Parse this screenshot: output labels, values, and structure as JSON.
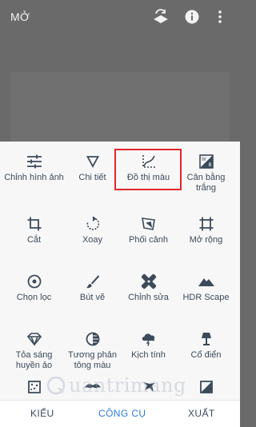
{
  "header": {
    "title": "MỞ",
    "icons": [
      "layers-undo-icon",
      "info-icon",
      "more-vert-icon"
    ]
  },
  "tools": [
    {
      "label": "Chỉnh hình ảnh",
      "icon": "tune-sliders-icon"
    },
    {
      "label": "Chi tiết",
      "icon": "details-triangle-icon"
    },
    {
      "label": "Đồ thị màu",
      "icon": "curves-icon"
    },
    {
      "label": "Cân bằng trắng",
      "icon": "white-balance-icon"
    },
    {
      "label": "Cắt",
      "icon": "crop-icon"
    },
    {
      "label": "Xoay",
      "icon": "rotate-icon"
    },
    {
      "label": "Phối cảnh",
      "icon": "perspective-icon"
    },
    {
      "label": "Mở rộng",
      "icon": "expand-icon"
    },
    {
      "label": "Chọn lọc",
      "icon": "selective-icon"
    },
    {
      "label": "Bút vẽ",
      "icon": "brush-icon"
    },
    {
      "label": "Chỉnh sửa",
      "icon": "healing-icon"
    },
    {
      "label": "HDR Scape",
      "icon": "hdr-mountain-icon"
    },
    {
      "label": "Tỏa sáng huyền ảo",
      "icon": "glamour-glow-icon"
    },
    {
      "label": "Tương phản tông màu",
      "icon": "tonal-contrast-icon"
    },
    {
      "label": "Kịch tính",
      "icon": "drama-cloud-icon"
    },
    {
      "label": "Cổ điển",
      "icon": "vintage-lamp-icon"
    },
    {
      "label": "",
      "icon": "grainy-film-icon"
    },
    {
      "label": "",
      "icon": "retrolux-mustache-icon"
    },
    {
      "label": "",
      "icon": "grunge-icon"
    },
    {
      "label": "",
      "icon": "black-white-icon"
    }
  ],
  "selected_tool": "Đồ thị màu",
  "bottom_tabs": {
    "styles": "KIỂU",
    "tools": "CÔNG CỤ",
    "export": "XUẤT"
  },
  "watermark": "uantrimang",
  "colors": {
    "accent": "#2d7be0",
    "highlight": "#e3262a",
    "icon": "#3c4a5a"
  }
}
